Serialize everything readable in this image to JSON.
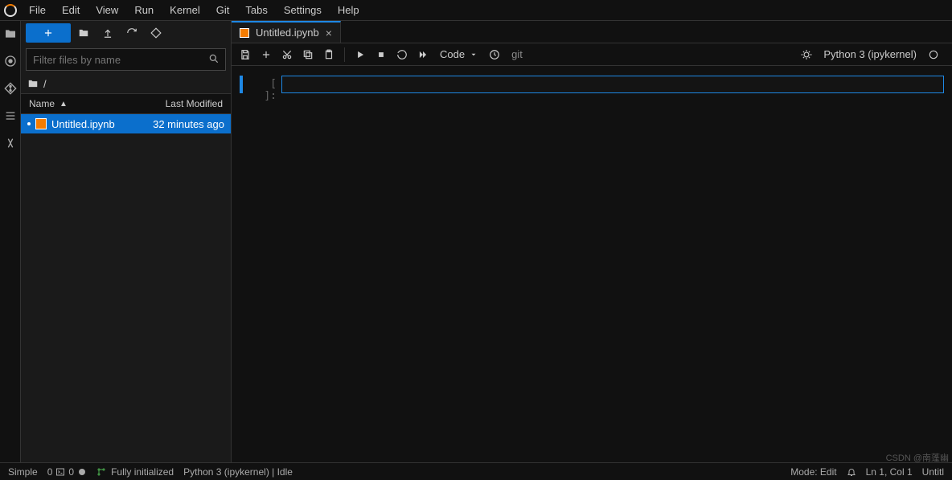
{
  "menu": {
    "items": [
      "File",
      "Edit",
      "View",
      "Run",
      "Kernel",
      "Git",
      "Tabs",
      "Settings",
      "Help"
    ]
  },
  "sidebar": {
    "search_placeholder": "Filter files by name",
    "breadcrumb_root": "/",
    "columns": {
      "name": "Name",
      "modified": "Last Modified"
    },
    "files": [
      {
        "name": "Untitled.ipynb",
        "modified": "32 minutes ago"
      }
    ]
  },
  "tabs": [
    {
      "label": "Untitled.ipynb"
    }
  ],
  "notebook_toolbar": {
    "cell_type": "Code",
    "git_label": "git",
    "kernel_label": "Python 3 (ipykernel)"
  },
  "cell": {
    "prompt": "[ ]:"
  },
  "statusbar": {
    "left1": "Simple",
    "terms": "0",
    "git_status": "Fully initialized",
    "kernel": "Python 3 (ipykernel) | Idle",
    "mode": "Mode: Edit",
    "pos": "Ln 1, Col 1",
    "file": "Untitl"
  },
  "watermark": "CSDN @南蓬幽"
}
